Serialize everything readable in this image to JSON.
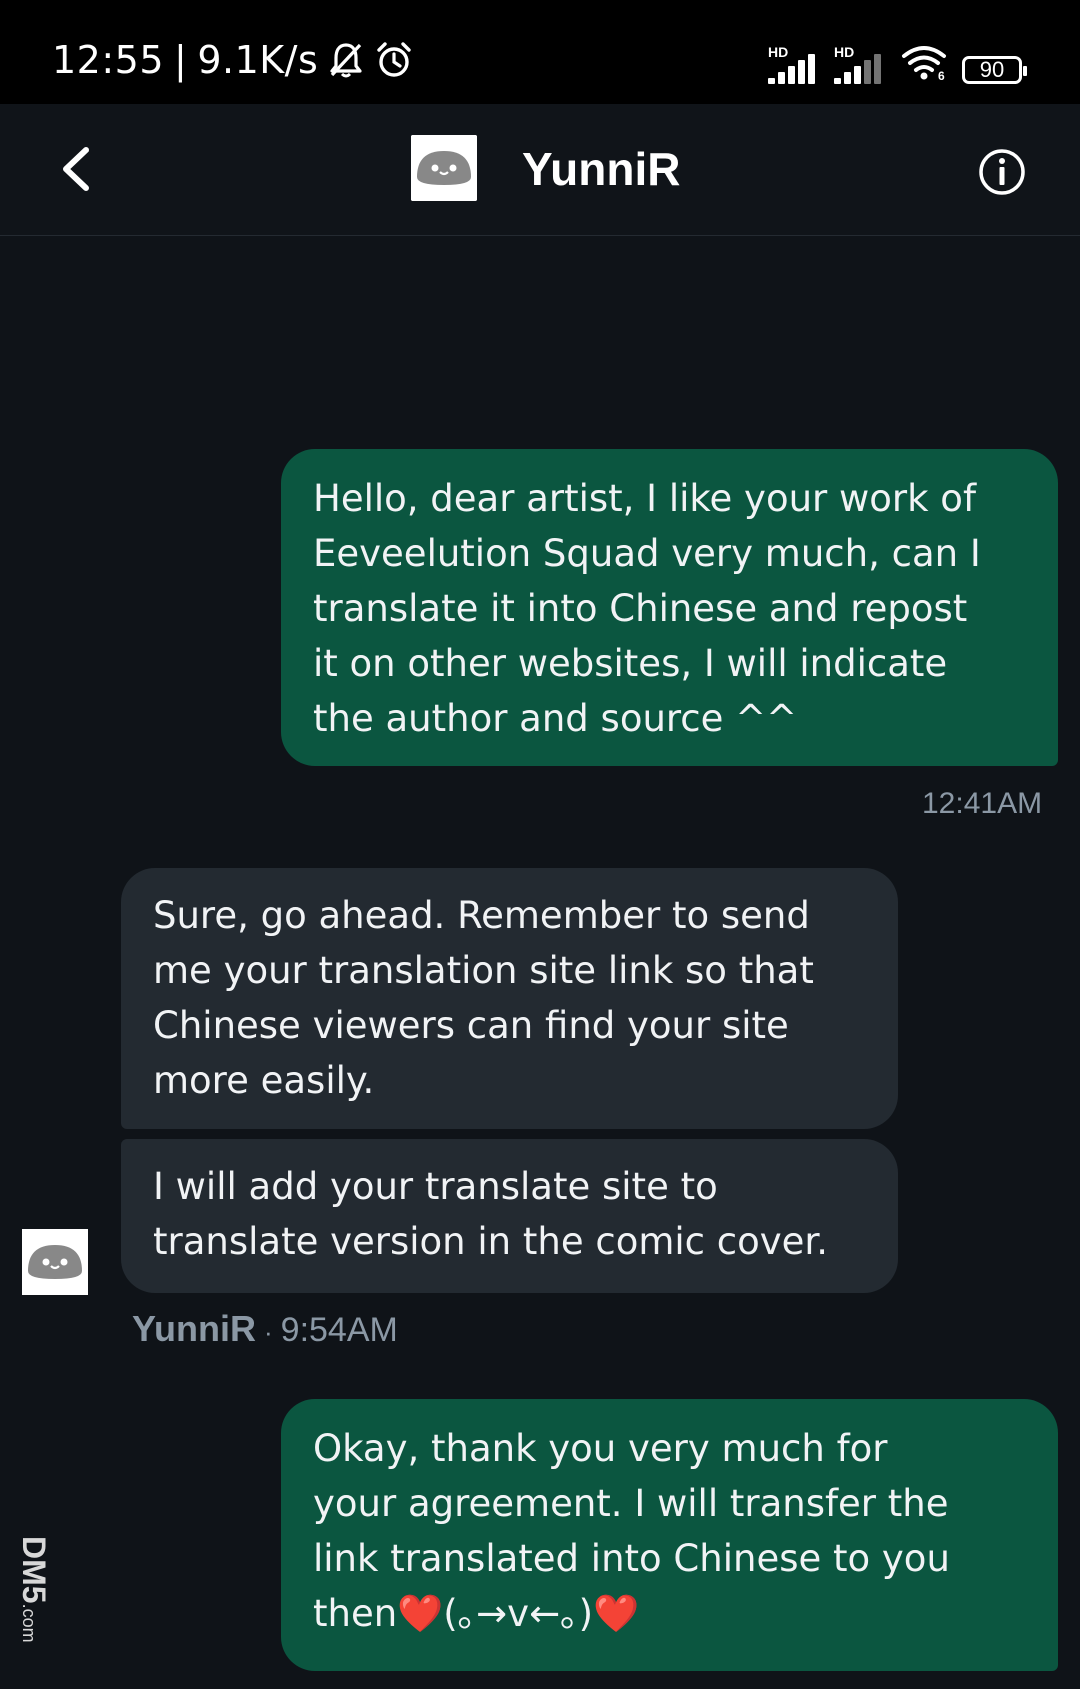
{
  "status_bar": {
    "time": "12:55",
    "separator": "|",
    "network_speed": "9.1K/s",
    "icons": [
      "bell-muted-icon",
      "alarm-icon",
      "signal-hd-icon",
      "signal-hd-icon",
      "wifi-icon"
    ],
    "signal_label_1": "HD",
    "signal_label_2": "HD",
    "battery": "90"
  },
  "header": {
    "contact_name": "YunniR",
    "back_icon": "chevron-left-icon",
    "info_icon": "info-icon"
  },
  "messages": [
    {
      "direction": "outgoing",
      "text": "Hello, dear artist, I like your work of\nEeveelution Squad very much, can I\ntranslate it into Chinese and repost\nit on other websites, I will indicate\nthe author and source ^^",
      "time": "12:41AM"
    },
    {
      "direction": "incoming",
      "text": "Sure, go ahead. Remember to send\nme your translation site link so that\nChinese viewers can find your site\nmore easily."
    },
    {
      "direction": "incoming",
      "text": "I will add your translate site to\ntranslate version in the comic cover."
    },
    {
      "direction": "outgoing",
      "text": "Okay, thank you very much for\nyour agreement. I will transfer the\nlink translated into Chinese to you\nthen❤️(｡→v←｡)❤️"
    }
  ],
  "incoming_meta": {
    "sender": "YunniR",
    "dot": "·",
    "time": "9:54AM"
  },
  "watermark": {
    "brand": "DM5",
    "suffix": ".com"
  },
  "colors": {
    "outgoing_bubble": "#0b5640",
    "incoming_bubble": "#232a31",
    "background": "#0f1318",
    "meta_text": "#8b98a5"
  }
}
